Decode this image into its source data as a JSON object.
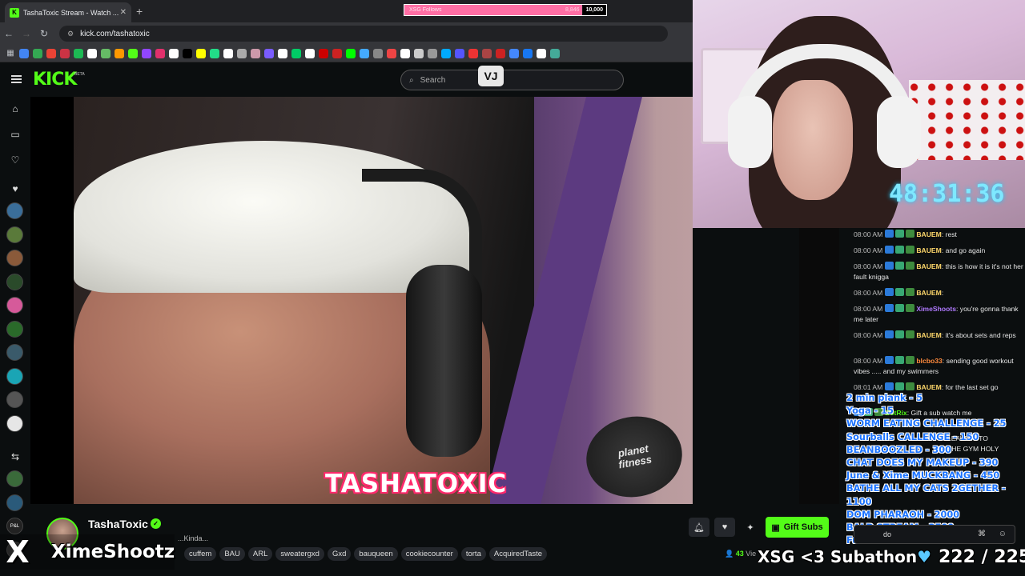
{
  "browser": {
    "tab_title": "TashaToxic Stream - Watch ...",
    "tab_favicon": "K",
    "url": "kick.com/tashatoxic",
    "bookmarks_colors": [
      "#4285f4",
      "#34a853",
      "#ea4335",
      "#c34",
      "#1db954",
      "#fff",
      "#6b6",
      "#f90",
      "#53fc18",
      "#9146ff",
      "#e1306c",
      "#fff",
      "#000",
      "#ff0",
      "#2d8",
      "#fff",
      "#aaa",
      "#c9a",
      "#7a5cff",
      "#fff",
      "#0c6",
      "#fff",
      "#c00",
      "#c22",
      "#0f0",
      "#4af",
      "#888",
      "#e44",
      "#fff",
      "#ccc",
      "#999",
      "#0af",
      "#55f",
      "#e33",
      "#a44",
      "#c22",
      "#48f",
      "#1877f2",
      "#fff",
      "#4a9"
    ]
  },
  "goal": {
    "label": "XSG Follows",
    "current": "8,846",
    "max": "10,000",
    "fraction": 0.88
  },
  "kick": {
    "logo": "KICK",
    "beta": "BETA",
    "search_placeholder": "Search",
    "overlay_badge": "VJ"
  },
  "sidebar": {
    "icons": [
      "home-icon",
      "following-icon",
      "heart-icon"
    ],
    "section_icon": "heart-icon",
    "avatar_colors": [
      "#3a6e9a",
      "#5a7a3a",
      "#8a5a3a",
      "#2a4a2a",
      "#d65a9a",
      "#2a6a2a",
      "#3a5a6a",
      "#1aa5b5",
      "#555",
      "#e6e6e6"
    ],
    "bottom_icon": "collapse-icon",
    "bottom_avatar_colors": [
      "#3a6a3a",
      "#2a5a7a",
      "#222",
      "#333"
    ],
    "bottom_avatar_labels": [
      "",
      "",
      "P&L",
      ""
    ]
  },
  "video": {
    "stream_title_overlay": "TASHATOXIC",
    "brand_top": "planet",
    "brand_bottom": "fitness"
  },
  "webcam": {
    "timer": "48:31:36"
  },
  "chat": {
    "messages": [
      {
        "time": "08:00 AM",
        "user": "BAUEM",
        "color": "#ffd86b",
        "text": "rest"
      },
      {
        "time": "08:00 AM",
        "user": "BAUEM",
        "color": "#ffd86b",
        "text": "and go again"
      },
      {
        "time": "08:00 AM",
        "user": "BAUEM",
        "color": "#ffd86b",
        "text": "this is how it is it's not her fault knigga"
      },
      {
        "time": "08:00 AM",
        "user": "BAUEM",
        "color": "#ffd86b",
        "text": ""
      },
      {
        "time": "08:00 AM",
        "user": "XimeShoots",
        "color": "#b07aff",
        "text": "you're gonna thank me later"
      },
      {
        "time": "08:00 AM",
        "user": "BAUEM",
        "color": "#ffd86b",
        "text": "it's about sets and reps"
      },
      {
        "time": "08:00 AM",
        "user": "blcbo33",
        "color": "#ff8a3d",
        "text": "sending good workout vibes ..... and my swimmers"
      },
      {
        "time": "08:01 AM",
        "user": "BAUEM",
        "color": "#ffd86b",
        "text": "for the last set go"
      },
      {
        "time": "",
        "user": "BotRix",
        "color": "#53fc18",
        "text": "Gift a sub watch me"
      },
      {
        "time": "",
        "user": "",
        "color": "#ddd",
        "text": "LEAVE IT TO"
      },
      {
        "time": "",
        "user": "",
        "color": "#ddd",
        "text": "THE GYM HOLY"
      }
    ],
    "input_value": "do",
    "input_icons": [
      "command-icon",
      "emoji-icon"
    ]
  },
  "subathon_menu": [
    "2 min plank - 5",
    "Yoga - 15",
    "WORM EATING CHALLENGE - 25",
    "Sourballs CALLENGE - 150",
    "BEANBOOZLED - 300",
    "CHAT DOES MY MAKEUP - 390",
    "June & Xime MUCKBANG - 450",
    "BATHE ALL MY CATS 2GETHER - 1100",
    "DOM PHARAOH - 2000",
    "BALD STREAM - 3500",
    "Full menu on PINNED CHAT"
  ],
  "channel": {
    "name": "TashaToxic",
    "subtitle_fragment": "...Kinda...",
    "tags": [
      "cuffem",
      "BAU",
      "ARL",
      "sweatergxd",
      "Gxd",
      "bauqueen",
      "cookiecounter",
      "torta",
      "AcquiredTaste"
    ],
    "viewers": "43",
    "viewers_label": "Vie",
    "gift_label": "Gift Subs"
  },
  "overlays": {
    "x_logo": "X",
    "x_handle": "XimeShootz",
    "subathon_text": "XSG <3 Subathon",
    "sub_count": "222 / 225"
  },
  "colors": {
    "kick_green": "#53fc18",
    "menu_blue": "#1b73ff",
    "title_pink": "#ff2a6d",
    "timer_cyan": "#7fe8ff"
  }
}
